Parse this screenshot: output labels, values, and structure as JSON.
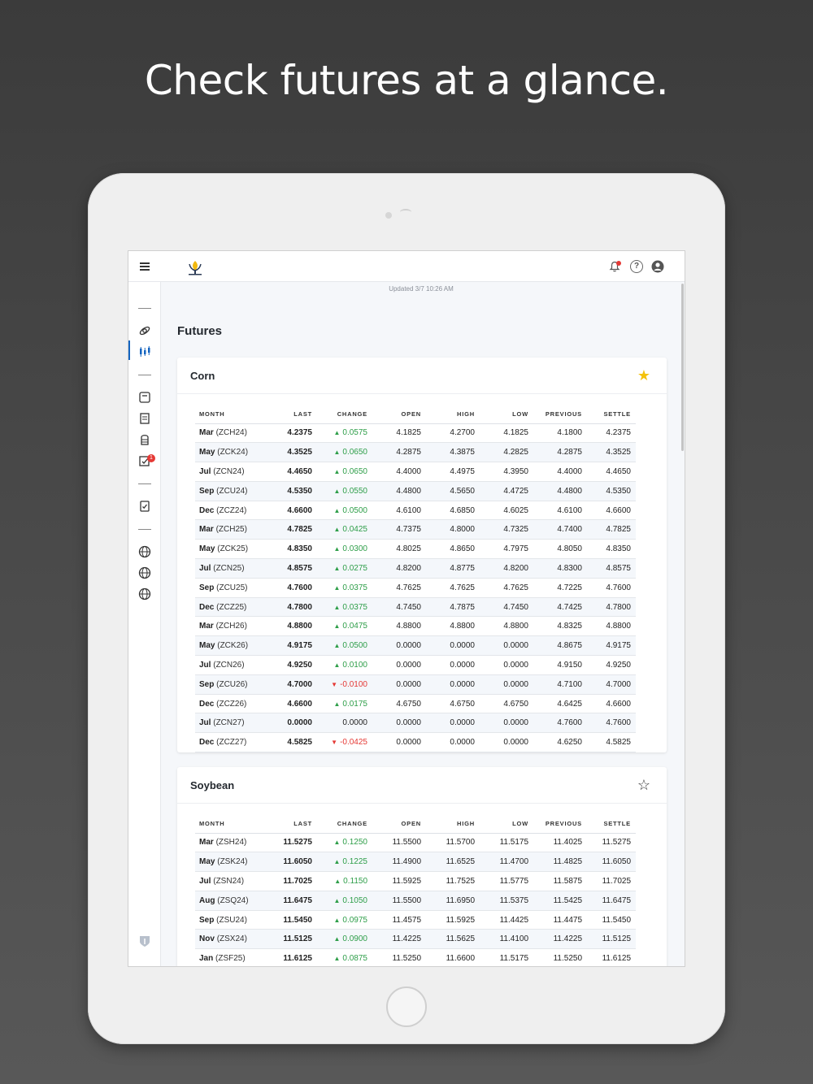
{
  "headline": "Check futures at a glance.",
  "app": {
    "updated": "Updated 3/7 10:26 AM",
    "page_title": "Futures",
    "colors": {
      "up": "#2e9e49",
      "down": "#e53935",
      "star_filled": "#f4c20d",
      "accent": "#1565c0"
    },
    "notification_badge": "1"
  },
  "columns": [
    "MONTH",
    "LAST",
    "CHANGE",
    "OPEN",
    "HIGH",
    "LOW",
    "PREVIOUS",
    "SETTLE"
  ],
  "cards": [
    {
      "title": "Corn",
      "favorite": true,
      "rows": [
        {
          "month": "Mar",
          "code": "(ZCH24)",
          "last": "4.2375",
          "change": "0.0575",
          "dir": "up",
          "open": "4.1825",
          "high": "4.2700",
          "low": "4.1825",
          "previous": "4.1800",
          "settle": "4.2375"
        },
        {
          "month": "May",
          "code": "(ZCK24)",
          "last": "4.3525",
          "change": "0.0650",
          "dir": "up",
          "open": "4.2875",
          "high": "4.3875",
          "low": "4.2825",
          "previous": "4.2875",
          "settle": "4.3525"
        },
        {
          "month": "Jul",
          "code": "(ZCN24)",
          "last": "4.4650",
          "change": "0.0650",
          "dir": "up",
          "open": "4.4000",
          "high": "4.4975",
          "low": "4.3950",
          "previous": "4.4000",
          "settle": "4.4650"
        },
        {
          "month": "Sep",
          "code": "(ZCU24)",
          "last": "4.5350",
          "change": "0.0550",
          "dir": "up",
          "open": "4.4800",
          "high": "4.5650",
          "low": "4.4725",
          "previous": "4.4800",
          "settle": "4.5350"
        },
        {
          "month": "Dec",
          "code": "(ZCZ24)",
          "last": "4.6600",
          "change": "0.0500",
          "dir": "up",
          "open": "4.6100",
          "high": "4.6850",
          "low": "4.6025",
          "previous": "4.6100",
          "settle": "4.6600"
        },
        {
          "month": "Mar",
          "code": "(ZCH25)",
          "last": "4.7825",
          "change": "0.0425",
          "dir": "up",
          "open": "4.7375",
          "high": "4.8000",
          "low": "4.7325",
          "previous": "4.7400",
          "settle": "4.7825"
        },
        {
          "month": "May",
          "code": "(ZCK25)",
          "last": "4.8350",
          "change": "0.0300",
          "dir": "up",
          "open": "4.8025",
          "high": "4.8650",
          "low": "4.7975",
          "previous": "4.8050",
          "settle": "4.8350"
        },
        {
          "month": "Jul",
          "code": "(ZCN25)",
          "last": "4.8575",
          "change": "0.0275",
          "dir": "up",
          "open": "4.8200",
          "high": "4.8775",
          "low": "4.8200",
          "previous": "4.8300",
          "settle": "4.8575"
        },
        {
          "month": "Sep",
          "code": "(ZCU25)",
          "last": "4.7600",
          "change": "0.0375",
          "dir": "up",
          "open": "4.7625",
          "high": "4.7625",
          "low": "4.7625",
          "previous": "4.7225",
          "settle": "4.7600"
        },
        {
          "month": "Dec",
          "code": "(ZCZ25)",
          "last": "4.7800",
          "change": "0.0375",
          "dir": "up",
          "open": "4.7450",
          "high": "4.7875",
          "low": "4.7450",
          "previous": "4.7425",
          "settle": "4.7800"
        },
        {
          "month": "Mar",
          "code": "(ZCH26)",
          "last": "4.8800",
          "change": "0.0475",
          "dir": "up",
          "open": "4.8800",
          "high": "4.8800",
          "low": "4.8800",
          "previous": "4.8325",
          "settle": "4.8800"
        },
        {
          "month": "May",
          "code": "(ZCK26)",
          "last": "4.9175",
          "change": "0.0500",
          "dir": "up",
          "open": "0.0000",
          "high": "0.0000",
          "low": "0.0000",
          "previous": "4.8675",
          "settle": "4.9175"
        },
        {
          "month": "Jul",
          "code": "(ZCN26)",
          "last": "4.9250",
          "change": "0.0100",
          "dir": "up",
          "open": "0.0000",
          "high": "0.0000",
          "low": "0.0000",
          "previous": "4.9150",
          "settle": "4.9250"
        },
        {
          "month": "Sep",
          "code": "(ZCU26)",
          "last": "4.7000",
          "change": "-0.0100",
          "dir": "down",
          "open": "0.0000",
          "high": "0.0000",
          "low": "0.0000",
          "previous": "4.7100",
          "settle": "4.7000"
        },
        {
          "month": "Dec",
          "code": "(ZCZ26)",
          "last": "4.6600",
          "change": "0.0175",
          "dir": "up",
          "open": "4.6750",
          "high": "4.6750",
          "low": "4.6750",
          "previous": "4.6425",
          "settle": "4.6600"
        },
        {
          "month": "Jul",
          "code": "(ZCN27)",
          "last": "0.0000",
          "change": "0.0000",
          "dir": "flat",
          "open": "0.0000",
          "high": "0.0000",
          "low": "0.0000",
          "previous": "4.7600",
          "settle": "4.7600"
        },
        {
          "month": "Dec",
          "code": "(ZCZ27)",
          "last": "4.5825",
          "change": "-0.0425",
          "dir": "down",
          "open": "0.0000",
          "high": "0.0000",
          "low": "0.0000",
          "previous": "4.6250",
          "settle": "4.5825"
        }
      ]
    },
    {
      "title": "Soybean",
      "favorite": false,
      "rows": [
        {
          "month": "Mar",
          "code": "(ZSH24)",
          "last": "11.5275",
          "change": "0.1250",
          "dir": "up",
          "open": "11.5500",
          "high": "11.5700",
          "low": "11.5175",
          "previous": "11.4025",
          "settle": "11.5275"
        },
        {
          "month": "May",
          "code": "(ZSK24)",
          "last": "11.6050",
          "change": "0.1225",
          "dir": "up",
          "open": "11.4900",
          "high": "11.6525",
          "low": "11.4700",
          "previous": "11.4825",
          "settle": "11.6050"
        },
        {
          "month": "Jul",
          "code": "(ZSN24)",
          "last": "11.7025",
          "change": "0.1150",
          "dir": "up",
          "open": "11.5925",
          "high": "11.7525",
          "low": "11.5775",
          "previous": "11.5875",
          "settle": "11.7025"
        },
        {
          "month": "Aug",
          "code": "(ZSQ24)",
          "last": "11.6475",
          "change": "0.1050",
          "dir": "up",
          "open": "11.5500",
          "high": "11.6950",
          "low": "11.5375",
          "previous": "11.5425",
          "settle": "11.6475"
        },
        {
          "month": "Sep",
          "code": "(ZSU24)",
          "last": "11.5450",
          "change": "0.0975",
          "dir": "up",
          "open": "11.4575",
          "high": "11.5925",
          "low": "11.4425",
          "previous": "11.4475",
          "settle": "11.5450"
        },
        {
          "month": "Nov",
          "code": "(ZSX24)",
          "last": "11.5125",
          "change": "0.0900",
          "dir": "up",
          "open": "11.4225",
          "high": "11.5625",
          "low": "11.4100",
          "previous": "11.4225",
          "settle": "11.5125"
        },
        {
          "month": "Jan",
          "code": "(ZSF25)",
          "last": "11.6125",
          "change": "0.0875",
          "dir": "up",
          "open": "11.5250",
          "high": "11.6600",
          "low": "11.5175",
          "previous": "11.5250",
          "settle": "11.6125"
        }
      ]
    }
  ]
}
